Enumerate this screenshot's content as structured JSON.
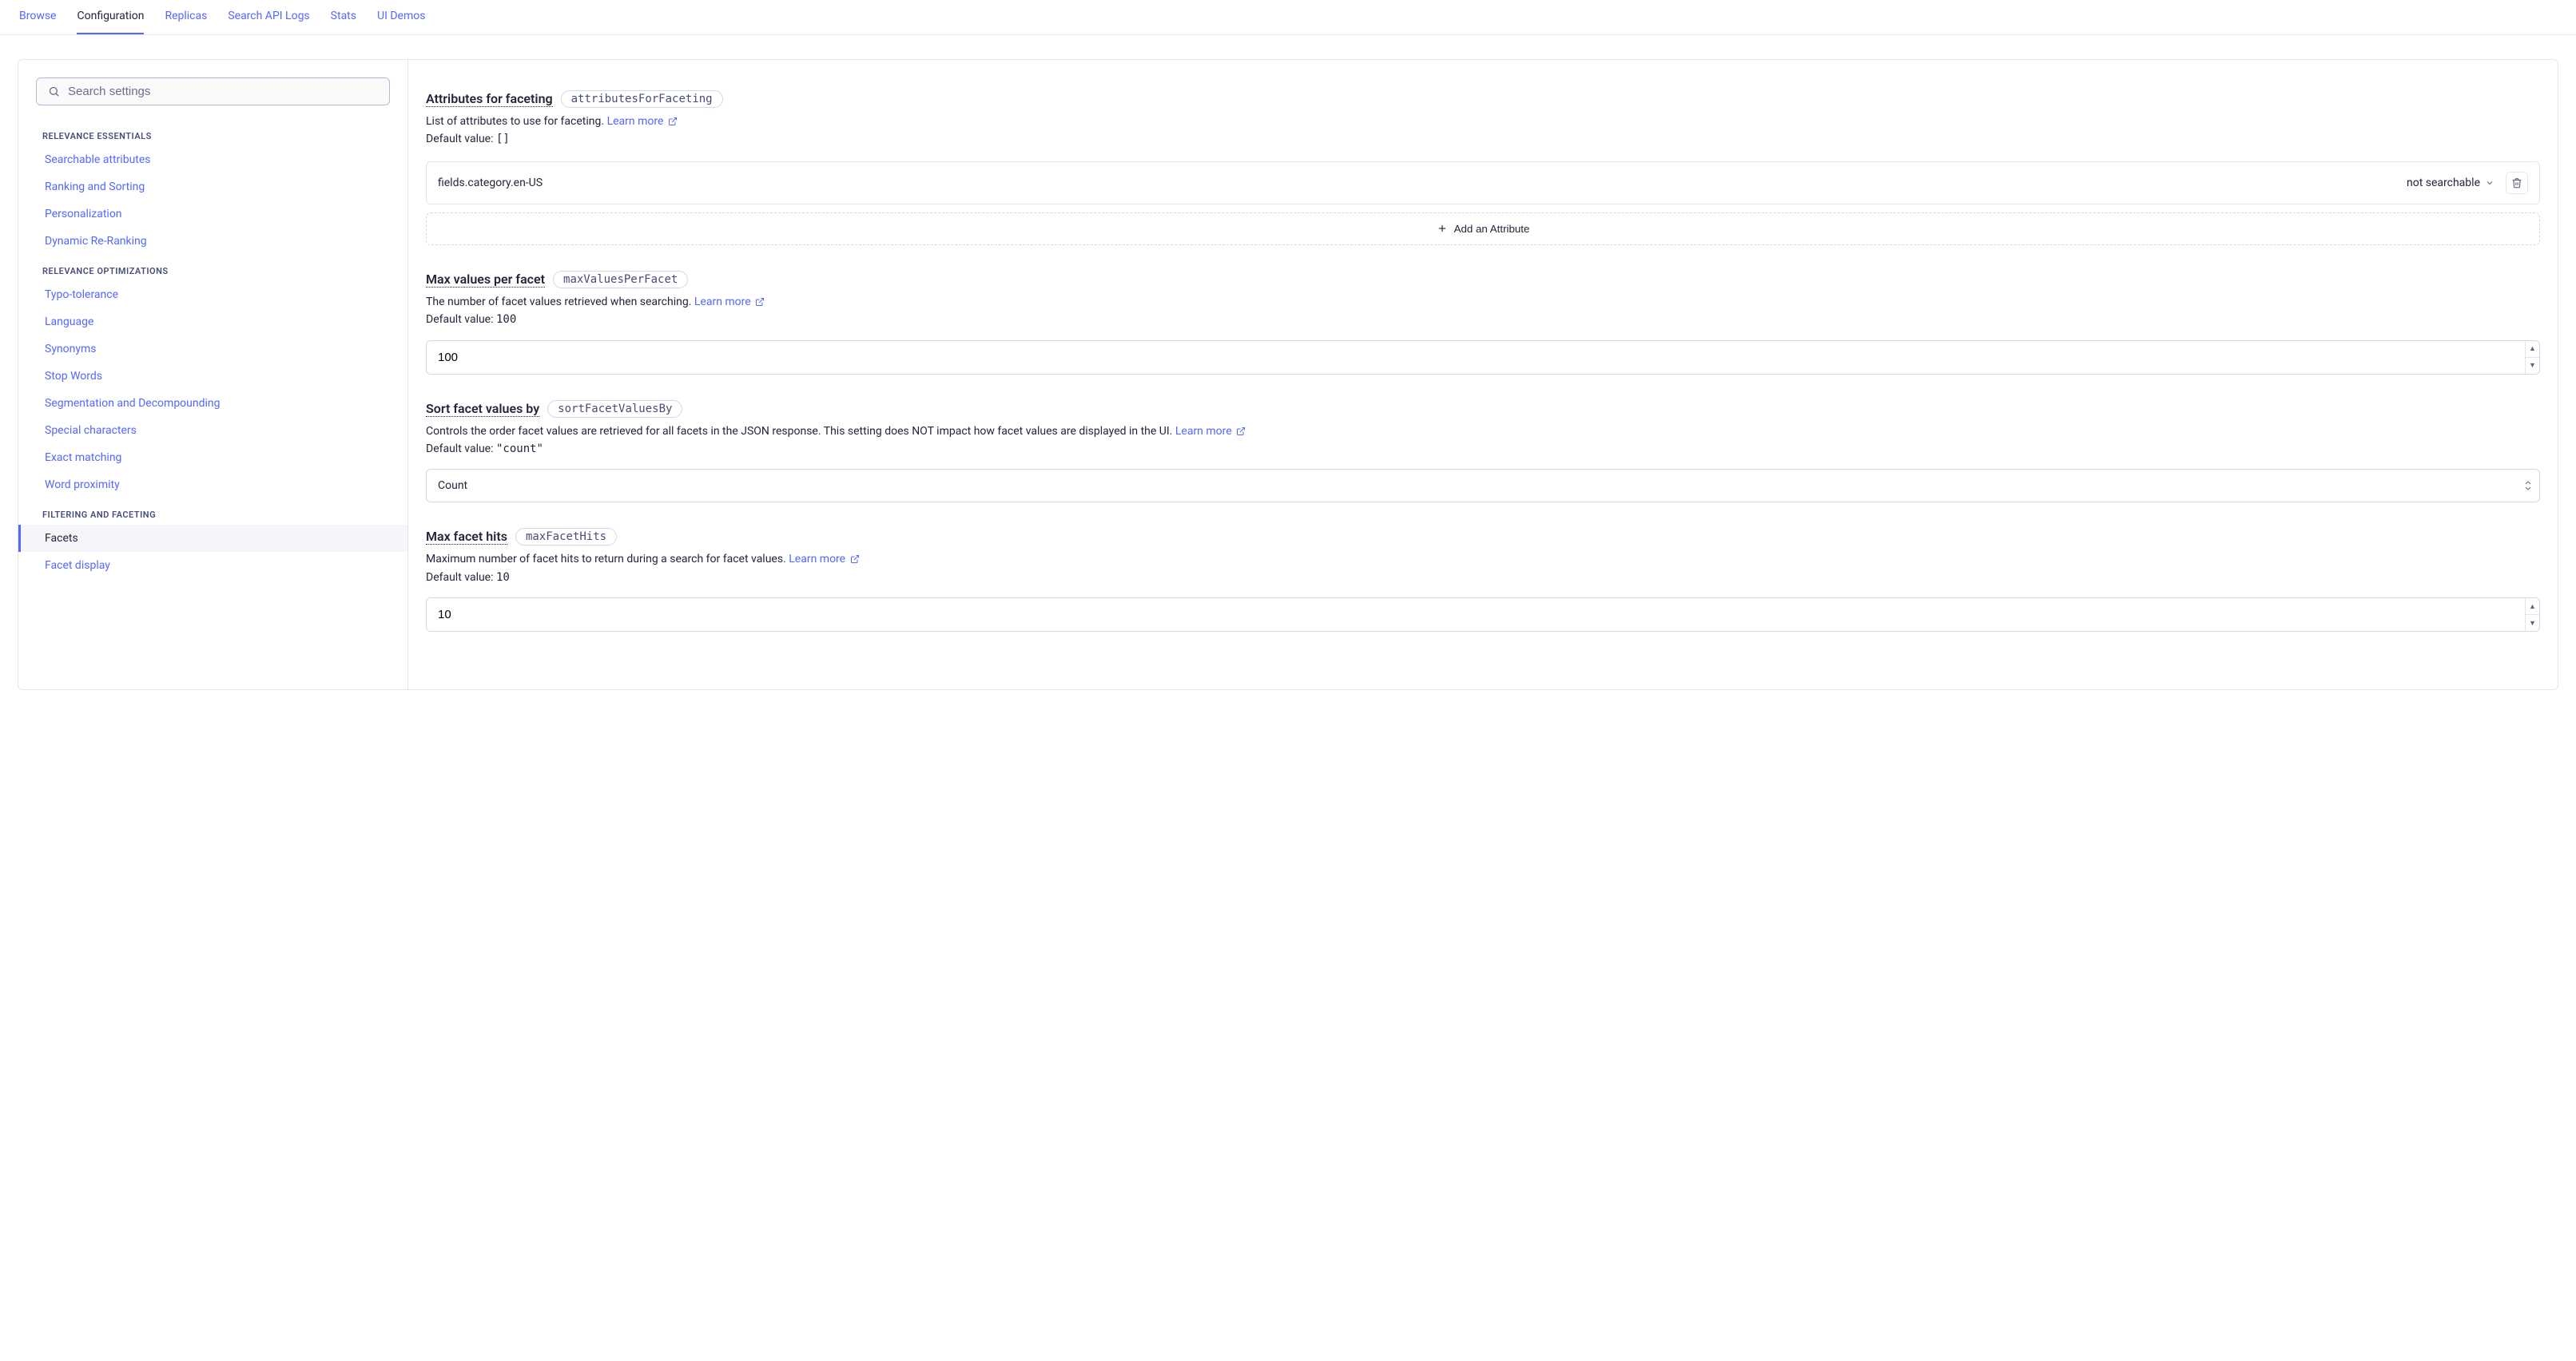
{
  "tabs": [
    {
      "label": "Browse"
    },
    {
      "label": "Configuration",
      "active": true
    },
    {
      "label": "Replicas"
    },
    {
      "label": "Search API Logs"
    },
    {
      "label": "Stats"
    },
    {
      "label": "UI Demos"
    }
  ],
  "search": {
    "placeholder": "Search settings"
  },
  "sidebar": [
    {
      "heading": "RELEVANCE ESSENTIALS"
    },
    {
      "item": "Searchable attributes"
    },
    {
      "item": "Ranking and Sorting"
    },
    {
      "item": "Personalization"
    },
    {
      "item": "Dynamic Re-Ranking"
    },
    {
      "heading": "RELEVANCE OPTIMIZATIONS"
    },
    {
      "item": "Typo-tolerance"
    },
    {
      "item": "Language"
    },
    {
      "item": "Synonyms"
    },
    {
      "item": "Stop Words"
    },
    {
      "item": "Segmentation and Decompounding"
    },
    {
      "item": "Special characters"
    },
    {
      "item": "Exact matching"
    },
    {
      "item": "Word proximity"
    },
    {
      "heading": "FILTERING AND FACETING"
    },
    {
      "item": "Facets",
      "active": true
    },
    {
      "item": "Facet display"
    }
  ],
  "settings": {
    "attributesForFaceting": {
      "title": "Attributes for faceting",
      "code": "attributesForFaceting",
      "desc": "List of attributes to use for faceting.",
      "learn": "Learn more",
      "defaultLabel": "Default value:",
      "defaultValue": "[]",
      "row": {
        "name": "fields.category.en-US",
        "selector": "not searchable"
      },
      "addLabel": "Add an Attribute"
    },
    "maxValuesPerFacet": {
      "title": "Max values per facet",
      "code": "maxValuesPerFacet",
      "desc": "The number of facet values retrieved when searching.",
      "learn": "Learn more",
      "defaultLabel": "Default value:",
      "defaultValue": "100",
      "value": "100"
    },
    "sortFacetValuesBy": {
      "title": "Sort facet values by",
      "code": "sortFacetValuesBy",
      "desc": "Controls the order facet values are retrieved for all facets in the JSON response. This setting does NOT impact how facet values are displayed in the UI.",
      "learn": "Learn more",
      "defaultLabel": "Default value:",
      "defaultValue": "\"count\"",
      "value": "Count"
    },
    "maxFacetHits": {
      "title": "Max facet hits",
      "code": "maxFacetHits",
      "desc": "Maximum number of facet hits to return during a search for facet values.",
      "learn": "Learn more",
      "defaultLabel": "Default value:",
      "defaultValue": "10",
      "value": "10"
    }
  }
}
